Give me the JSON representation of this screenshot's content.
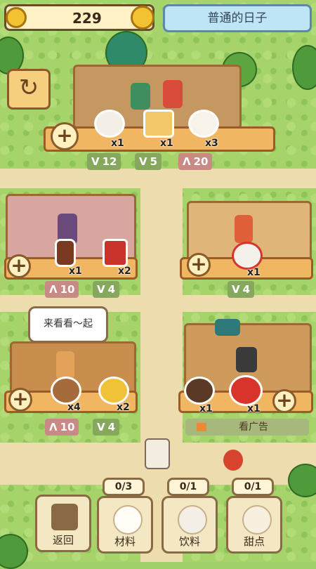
{
  "header": {
    "coins": "229",
    "day_label": "普通的日子"
  },
  "top_stall": {
    "items": [
      {
        "name": "egg",
        "qty": "x1"
      },
      {
        "name": "cake-slice",
        "qty": "x1"
      },
      {
        "name": "milk",
        "qty": "x3"
      }
    ],
    "stats": [
      {
        "kind": "up",
        "value": "12"
      },
      {
        "kind": "up",
        "value": "5"
      },
      {
        "kind": "down",
        "value": "20"
      }
    ]
  },
  "left_stall": {
    "items": [
      {
        "name": "bottle",
        "qty": "x1"
      },
      {
        "name": "jam-jar",
        "qty": "x2"
      }
    ],
    "stats": [
      {
        "kind": "down",
        "value": "10"
      },
      {
        "kind": "up",
        "value": "4"
      }
    ]
  },
  "right_stall": {
    "items": [
      {
        "name": "candy-cane",
        "qty": "x1"
      }
    ],
    "stats": [
      {
        "kind": "up",
        "value": "4"
      }
    ]
  },
  "bottom_left_stall": {
    "speech": "来看看～起",
    "items": [
      {
        "name": "roast-chicken",
        "qty": "x4"
      },
      {
        "name": "lemon",
        "qty": "x2"
      }
    ],
    "stats": [
      {
        "kind": "down",
        "value": "10"
      },
      {
        "kind": "up",
        "value": "4"
      }
    ]
  },
  "bottom_right_stall": {
    "items": [
      {
        "name": "pan",
        "qty": "x1"
      },
      {
        "name": "tomato",
        "qty": "x1"
      }
    ],
    "ad_label": "看广告"
  },
  "menu": {
    "back": "返回",
    "materials": {
      "label": "材料",
      "count": "0/3"
    },
    "drinks": {
      "label": "饮料",
      "count": "0/1"
    },
    "desserts": {
      "label": "甜点",
      "count": "0/1"
    }
  },
  "colors": {
    "up_chip": "#86a85c",
    "down_chip": "#c98a86",
    "accent_wood": "#f0b662"
  }
}
